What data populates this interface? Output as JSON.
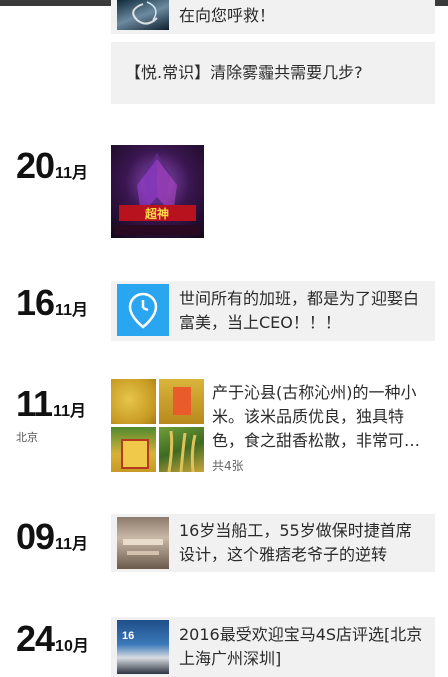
{
  "feed": [
    {
      "kind": "partial",
      "text": "在向您呼救！"
    },
    {
      "kind": "text",
      "text": "【悦.常识】清除雾霾共需要几步?"
    },
    {
      "day": "20",
      "month": "11月",
      "kind": "image",
      "image": "game-hero-poster"
    },
    {
      "day": "16",
      "month": "11月",
      "kind": "link",
      "icon": "clock-pin-icon",
      "text": "世间所有的加班，都是为了迎娶白富美，当上CEO！！！"
    },
    {
      "day": "11",
      "month": "11月",
      "location": "北京",
      "kind": "gallery",
      "text": "产于沁县(古称沁州)的一种小米。该米品质优良，独具特色，食之甜香松散，非常可…",
      "count": "共4张"
    },
    {
      "day": "09",
      "month": "11月",
      "kind": "link",
      "text": "16岁当船工，55岁做保时捷首席设计，这个雅痞老爷子的逆转"
    },
    {
      "day": "24",
      "month": "10月",
      "kind": "link",
      "text": "2016最受欢迎宝马4S店评选[北京上海广州深圳]",
      "thumb_label": "16"
    }
  ],
  "colors": {
    "accent": "#2aa6f0",
    "card": "#f1f1f1"
  }
}
